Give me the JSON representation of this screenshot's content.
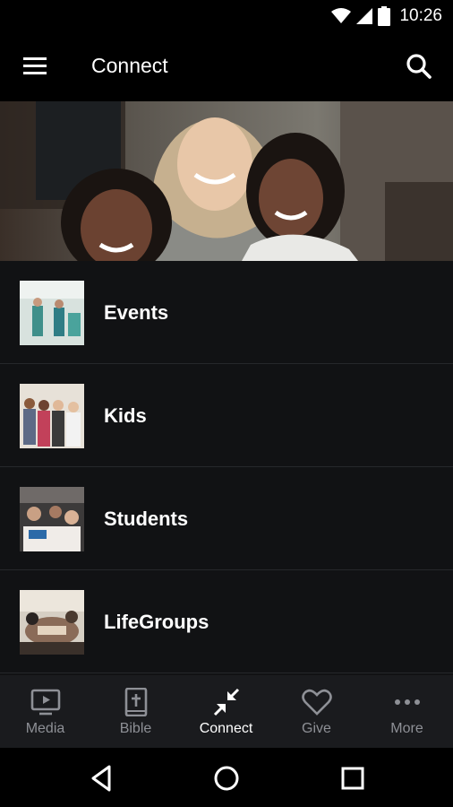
{
  "status_bar": {
    "time": "10:26",
    "icons": [
      "wifi-icon",
      "cell-signal-icon",
      "battery-icon"
    ]
  },
  "app_bar": {
    "title": "Connect",
    "menu_icon": "hamburger-menu-icon",
    "search_icon": "search-icon"
  },
  "hero": {
    "image": "photo of a smiling woman with two smiling children"
  },
  "list": {
    "items": [
      {
        "label": "Events",
        "thumb": "events-photo"
      },
      {
        "label": "Kids",
        "thumb": "kids-photo"
      },
      {
        "label": "Students",
        "thumb": "students-photo"
      },
      {
        "label": "LifeGroups",
        "thumb": "lifegroups-photo"
      }
    ]
  },
  "bottom_nav": {
    "active": "Connect",
    "tabs": [
      {
        "label": "Media",
        "icon": "tv-play-icon"
      },
      {
        "label": "Bible",
        "icon": "bible-icon"
      },
      {
        "label": "Connect",
        "icon": "connect-arrows-icon"
      },
      {
        "label": "Give",
        "icon": "heart-icon"
      },
      {
        "label": "More",
        "icon": "more-dots-icon"
      }
    ]
  },
  "system_nav": {
    "icons": [
      "back-icon",
      "home-icon",
      "recents-icon"
    ]
  },
  "colors": {
    "background": "#000000",
    "list_bg": "#111214",
    "nav_bg": "#1a1b1e",
    "inactive": "#8e9096",
    "active": "#ffffff"
  }
}
